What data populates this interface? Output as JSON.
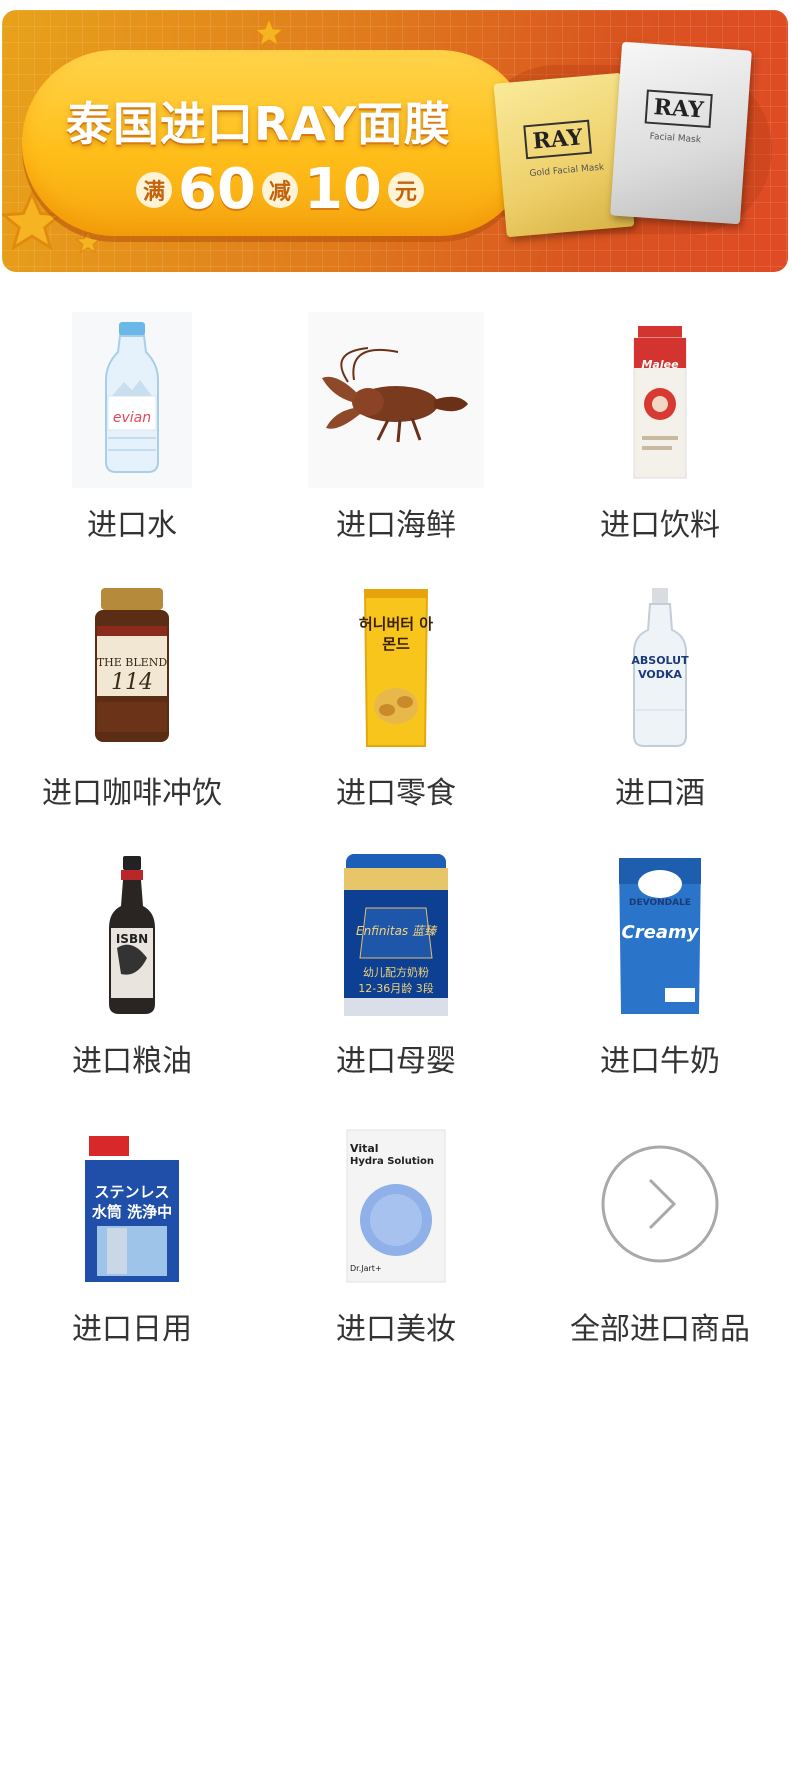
{
  "banner": {
    "title": "泰国进口RAY面膜",
    "promo": {
      "prefix": "满",
      "threshold": "60",
      "middle": "减",
      "discount": "10",
      "suffix": "元"
    },
    "products": [
      {
        "brand": "RAY",
        "subtitle": "Gold Facial Mask"
      },
      {
        "brand": "RAY",
        "subtitle": "Facial Mask"
      }
    ]
  },
  "categories": [
    {
      "label": "进口水",
      "icon": "water-bottle-icon",
      "product_text": "evian"
    },
    {
      "label": "进口海鲜",
      "icon": "lobster-icon"
    },
    {
      "label": "进口饮料",
      "icon": "juice-carton-icon",
      "product_text": "Malee"
    },
    {
      "label": "进口咖啡冲饮",
      "icon": "coffee-jar-icon",
      "product_text_1": "THE BLEND",
      "product_text_2": "114"
    },
    {
      "label": "进口零食",
      "icon": "snack-bag-icon",
      "product_text": "허니버터 아몬드"
    },
    {
      "label": "进口酒",
      "icon": "vodka-bottle-icon",
      "product_text_1": "ABSOLUT",
      "product_text_2": "VODKA"
    },
    {
      "label": "进口粮油",
      "icon": "sauce-bottle-icon",
      "product_text": "ISBN"
    },
    {
      "label": "进口母婴",
      "icon": "formula-can-icon",
      "product_text_1": "Enfinitas 蓝臻",
      "product_text_2": "幼儿配方奶粉",
      "product_text_3": "12-36月龄 3段"
    },
    {
      "label": "进口牛奶",
      "icon": "milk-powder-icon",
      "product_text_1": "DEVONDALE",
      "product_text_2": "Creamy"
    },
    {
      "label": "进口日用",
      "icon": "cleaner-box-icon",
      "product_text": "ステンレス水筒 洗浄中"
    },
    {
      "label": "进口美妆",
      "icon": "face-mask-icon",
      "product_text_1": "Vital",
      "product_text_2": "Hydra Solution",
      "product_text_3": "Dr.Jart+"
    },
    {
      "label": "全部进口商品",
      "icon": "chevron-right-circle-icon"
    }
  ]
}
